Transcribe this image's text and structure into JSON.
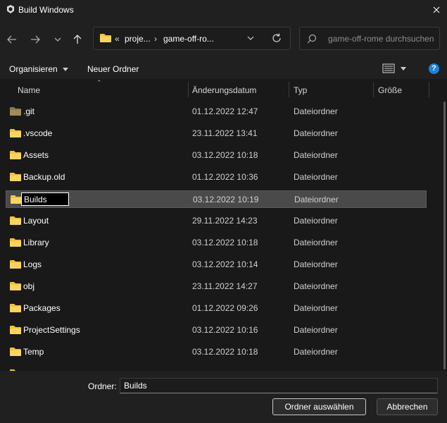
{
  "window": {
    "title": "Build Windows"
  },
  "nav": {
    "breadcrumb_prefix": "«",
    "breadcrumbs": [
      "proje...",
      "game-off-ro..."
    ],
    "search_placeholder": "game-off-rome durchsuchen"
  },
  "toolbar": {
    "organize_label": "Organisieren",
    "new_folder_label": "Neuer Ordner",
    "help_label": "?"
  },
  "columns": {
    "name": "Name",
    "date": "Änderungsdatum",
    "type": "Typ",
    "size": "Größe"
  },
  "rows": [
    {
      "name": ".git",
      "date": "01.12.2022 12:47",
      "type": "Dateiordner"
    },
    {
      "name": ".vscode",
      "date": "23.11.2022 13:41",
      "type": "Dateiordner"
    },
    {
      "name": "Assets",
      "date": "03.12.2022 10:18",
      "type": "Dateiordner"
    },
    {
      "name": "Backup.old",
      "date": "01.12.2022 10:36",
      "type": "Dateiordner"
    },
    {
      "name": "Builds",
      "date": "03.12.2022 10:19",
      "type": "Dateiordner"
    },
    {
      "name": "Layout",
      "date": "29.11.2022 14:23",
      "type": "Dateiordner"
    },
    {
      "name": "Library",
      "date": "03.12.2022 10:18",
      "type": "Dateiordner"
    },
    {
      "name": "Logs",
      "date": "03.12.2022 10:14",
      "type": "Dateiordner"
    },
    {
      "name": "obj",
      "date": "23.11.2022 14:27",
      "type": "Dateiordner"
    },
    {
      "name": "Packages",
      "date": "01.12.2022 09:26",
      "type": "Dateiordner"
    },
    {
      "name": "ProjectSettings",
      "date": "03.12.2022 10:16",
      "type": "Dateiordner"
    },
    {
      "name": "Temp",
      "date": "03.12.2022 10:18",
      "type": "Dateiordner"
    }
  ],
  "footer": {
    "folder_label": "Ordner:",
    "folder_value": "Builds",
    "select_button": "Ordner auswählen",
    "cancel_button": "Abbrechen"
  },
  "colors": {
    "background": "#191919",
    "panel": "#202020",
    "folder": "#f3c33f",
    "selection": "#4a4a4a",
    "help": "#1e82d8"
  },
  "icons": [
    "app-icon",
    "close-icon",
    "back-arrow-icon",
    "forward-arrow-icon",
    "chevron-down-icon",
    "up-arrow-icon",
    "folder-icon",
    "refresh-icon",
    "search-icon",
    "view-options-icon",
    "help-icon"
  ]
}
